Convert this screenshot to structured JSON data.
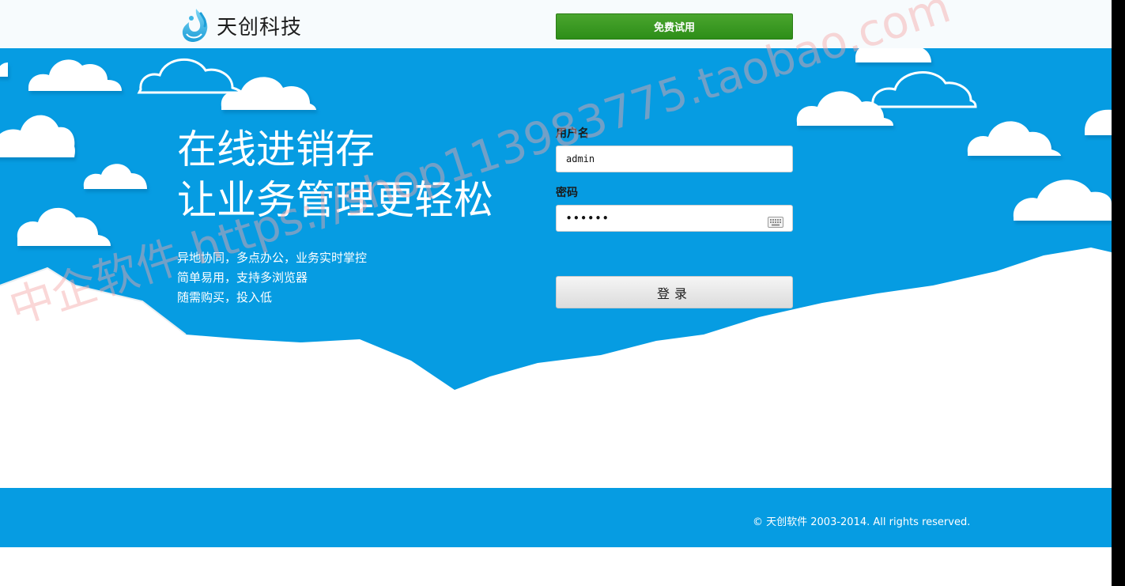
{
  "brand": {
    "name": "天创科技"
  },
  "header": {
    "trial_label": "免费试用"
  },
  "hero": {
    "headline_line1": "在线进销存",
    "headline_line2": "让业务管理更轻松",
    "taglines": [
      "异地协同，多点办公，业务实时掌控",
      "简单易用，支持多浏览器",
      "随需购买，投入低"
    ]
  },
  "login": {
    "username_label": "用户名",
    "username_value": "admin",
    "password_label": "密码",
    "password_value": "••••••",
    "submit_label": "登录"
  },
  "footer": {
    "copyright": "© 天创软件 2003-2014. All rights reserved."
  },
  "watermark": {
    "text": "中企软件 https://shop113983775.taobao.com"
  },
  "icons": {
    "logo": "flame-drop-logo-icon",
    "keyboard": "keyboard-icon"
  },
  "colors": {
    "sky": "#069ce2",
    "trial_button": "#3b9b24",
    "header_bg": "#f7fbfd"
  }
}
